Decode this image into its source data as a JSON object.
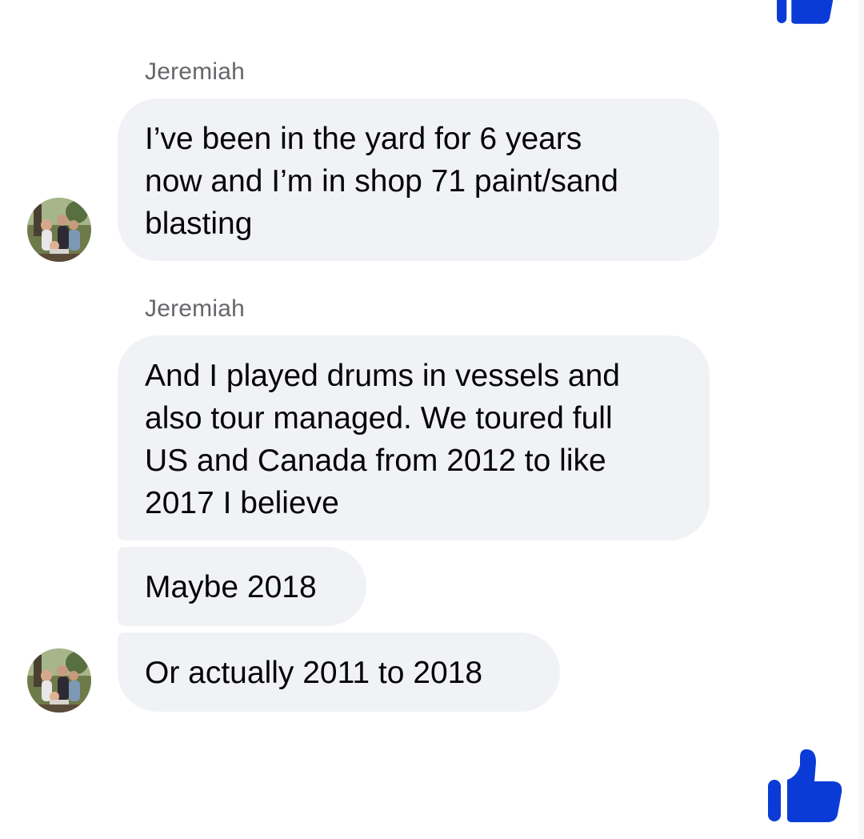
{
  "colors": {
    "bubble_bg": "#f1f2f6",
    "sender_text": "#65676b",
    "message_text": "#050505",
    "like_blue": "#0a3bd6"
  },
  "messages": [
    {
      "sender": "Jeremiah",
      "text": "I’ve been in the yard for 6 years\nnow and I’m in shop 71 paint/sand\nblasting"
    },
    {
      "sender": "Jeremiah",
      "text": "And I played drums in vessels and\nalso tour managed. We toured full\nUS and Canada from 2012 to like\n2017 I believe"
    },
    {
      "text": "Maybe 2018"
    },
    {
      "text": "Or actually 2011 to 2018"
    }
  ],
  "icons": {
    "like": "thumbs-up-icon",
    "avatar": "profile-photo"
  }
}
